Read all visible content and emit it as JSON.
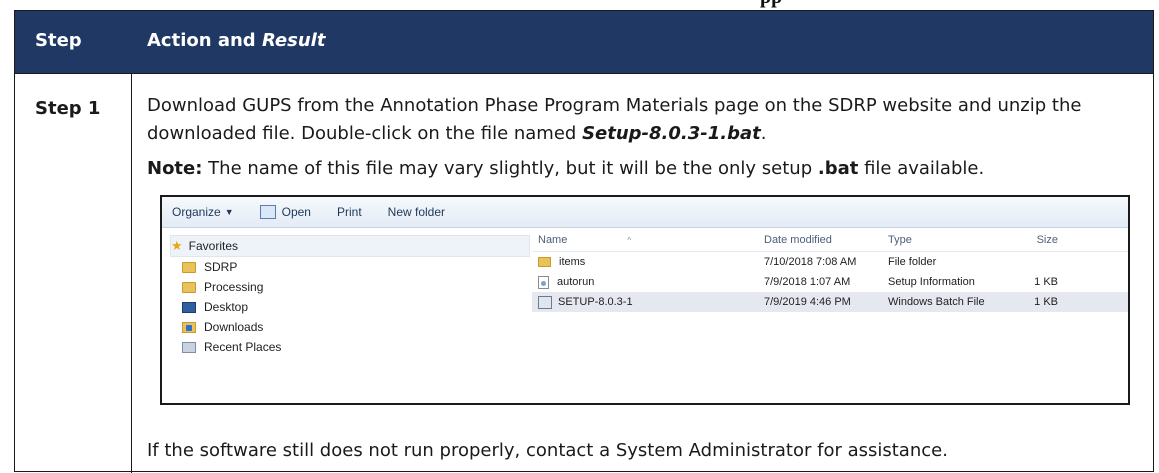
{
  "top_fragment": "pp",
  "table": {
    "headers": {
      "step": "Step",
      "action": "Action and",
      "result": "Result"
    },
    "row": {
      "step": "Step 1",
      "p1_text": "Download GUPS from the Annotation Phase Program Materials page on the SDRP website and unzip the downloaded file. Double-click on the file named ",
      "p1_file": "Setup-8.0.3-1.bat",
      "p1_end": ".",
      "note_label": "Note:",
      "note_text": " The name of this file may vary slightly, but it will be the only setup ",
      "note_ext": ".bat",
      "note_end": " file available.",
      "footer": "If the software still does not run properly, contact a System Administrator for assistance."
    }
  },
  "explorer": {
    "toolbar": {
      "organize": "Organize",
      "open": "Open",
      "print": "Print",
      "new_folder": "New folder"
    },
    "nav": {
      "favorites": "Favorites",
      "items": [
        "SDRP",
        "Processing",
        "Desktop",
        "Downloads",
        "Recent Places"
      ]
    },
    "columns": {
      "name": "Name",
      "date": "Date modified",
      "type": "Type",
      "size": "Size"
    },
    "files": [
      {
        "name": "items",
        "date": "7/10/2018 7:08 AM",
        "type": "File folder",
        "size": ""
      },
      {
        "name": "autorun",
        "date": "7/9/2018 1:07 AM",
        "type": "Setup Information",
        "size": "1 KB"
      },
      {
        "name": "SETUP-8.0.3-1",
        "date": "7/9/2019 4:46 PM",
        "type": "Windows Batch File",
        "size": "1 KB"
      }
    ],
    "colors": {
      "header_bg": "#1f3864",
      "folder": "#e9c25a",
      "selected_row": "#e5e9ef"
    }
  }
}
